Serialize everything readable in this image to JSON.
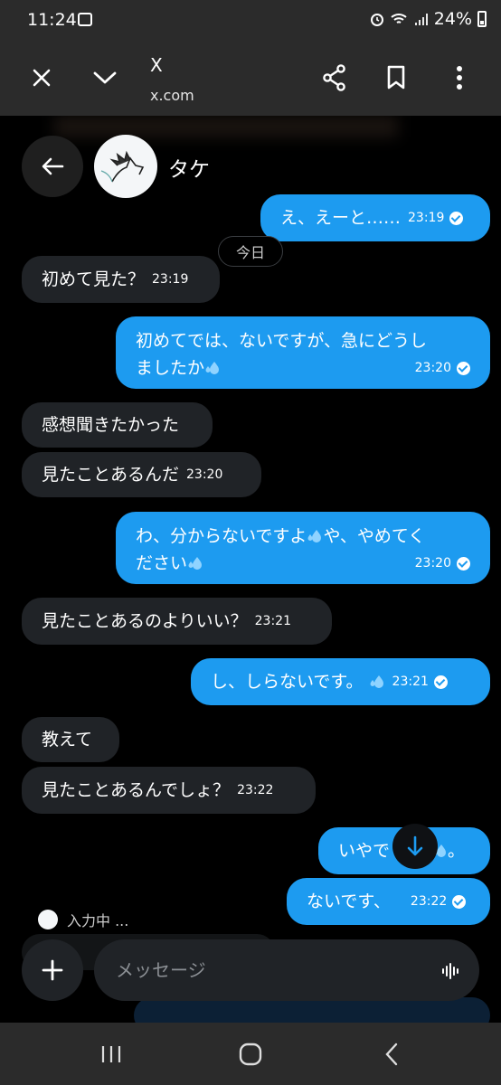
{
  "status_bar": {
    "time": "11:24",
    "battery": "24%"
  },
  "browser": {
    "title": "X",
    "url": "x.com"
  },
  "chat": {
    "contact_name": "タケ",
    "date_separator": "今日",
    "messages": [
      {
        "text": "え、えーと……",
        "time": "23:19"
      },
      {
        "text": "初めて見た？",
        "time": "23:19"
      },
      {
        "line1": "初めてでは、ないですが、急にどうし",
        "line2": "ましたか",
        "time": "23:20"
      },
      {
        "text": "感想聞きたかった"
      },
      {
        "text": "見たことあるんだ",
        "time": "23:20"
      },
      {
        "line1_a": "わ、分からないですよ",
        "line1_b": "や、やめてく",
        "line2": "ださい",
        "time": "23:20"
      },
      {
        "text": "見たことあるのよりいい？",
        "time": "23:21"
      },
      {
        "text": "し、しらないです。",
        "time": "23:21"
      },
      {
        "text": "教えて"
      },
      {
        "text": "見たことあるんでしょ？",
        "time": "23:22"
      },
      {
        "text_a": "いやで",
        "text_b": "。"
      },
      {
        "text": "ないです、",
        "time": "23:22"
      }
    ],
    "typing_text": "入力中 ..."
  },
  "composer": {
    "placeholder": "メッセージ"
  },
  "colors": {
    "sent_bubble": "#1d9bf0",
    "received_bubble": "#202327",
    "background": "#000000"
  },
  "icons": [
    "close-icon",
    "chevron-down-icon",
    "share-icon",
    "bookmark-icon",
    "more-vertical-icon",
    "back-arrow-icon",
    "arrow-down-icon",
    "plus-icon",
    "voice-wave-icon",
    "sweat-drop-emoji",
    "read-check-icon"
  ]
}
